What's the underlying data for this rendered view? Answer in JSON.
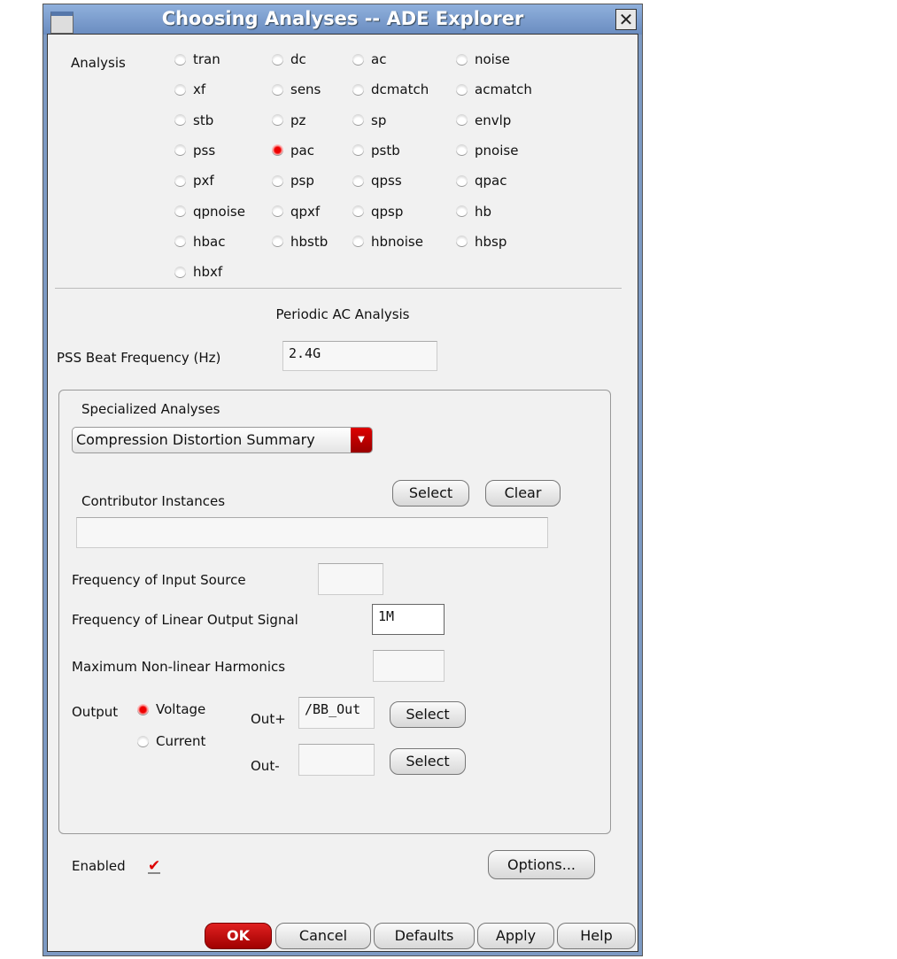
{
  "window": {
    "title": "Choosing Analyses -- ADE Explorer"
  },
  "analysis": {
    "label": "Analysis",
    "selected": "pac",
    "options": [
      "tran",
      "dc",
      "ac",
      "noise",
      "xf",
      "sens",
      "dcmatch",
      "acmatch",
      "stb",
      "pz",
      "sp",
      "envlp",
      "pss",
      "pac",
      "pstb",
      "pnoise",
      "pxf",
      "psp",
      "qpss",
      "qpac",
      "qpnoise",
      "qpxf",
      "qpsp",
      "hb",
      "hbac",
      "hbstb",
      "hbnoise",
      "hbsp",
      "hbxf"
    ]
  },
  "section_title": "Periodic AC Analysis",
  "pss_beat": {
    "label": "PSS Beat Frequency (Hz)",
    "value": "2.4G"
  },
  "specialized": {
    "label": "Specialized Analyses",
    "value": "Compression Distortion Summary"
  },
  "contributor": {
    "label": "Contributor Instances",
    "value": "",
    "select": "Select",
    "clear": "Clear"
  },
  "freq_input": {
    "label": "Frequency of Input Source",
    "value": ""
  },
  "freq_linear": {
    "label": "Frequency of Linear Output Signal",
    "value": "1M"
  },
  "max_harm": {
    "label": "Maximum Non-linear Harmonics",
    "value": ""
  },
  "output": {
    "label": "Output",
    "voltage": "Voltage",
    "current": "Current",
    "selected": "Voltage",
    "outp_label": "Out+",
    "outp_value": "/BB_Out",
    "outn_label": "Out-",
    "outn_value": "",
    "select": "Select"
  },
  "enabled": {
    "label": "Enabled",
    "checked": true
  },
  "buttons": {
    "options": "Options...",
    "ok": "OK",
    "cancel": "Cancel",
    "defaults": "Defaults",
    "apply": "Apply",
    "help": "Help"
  },
  "colors": {
    "accent": "#cc0000",
    "title_bar": "#7d9ac4"
  }
}
